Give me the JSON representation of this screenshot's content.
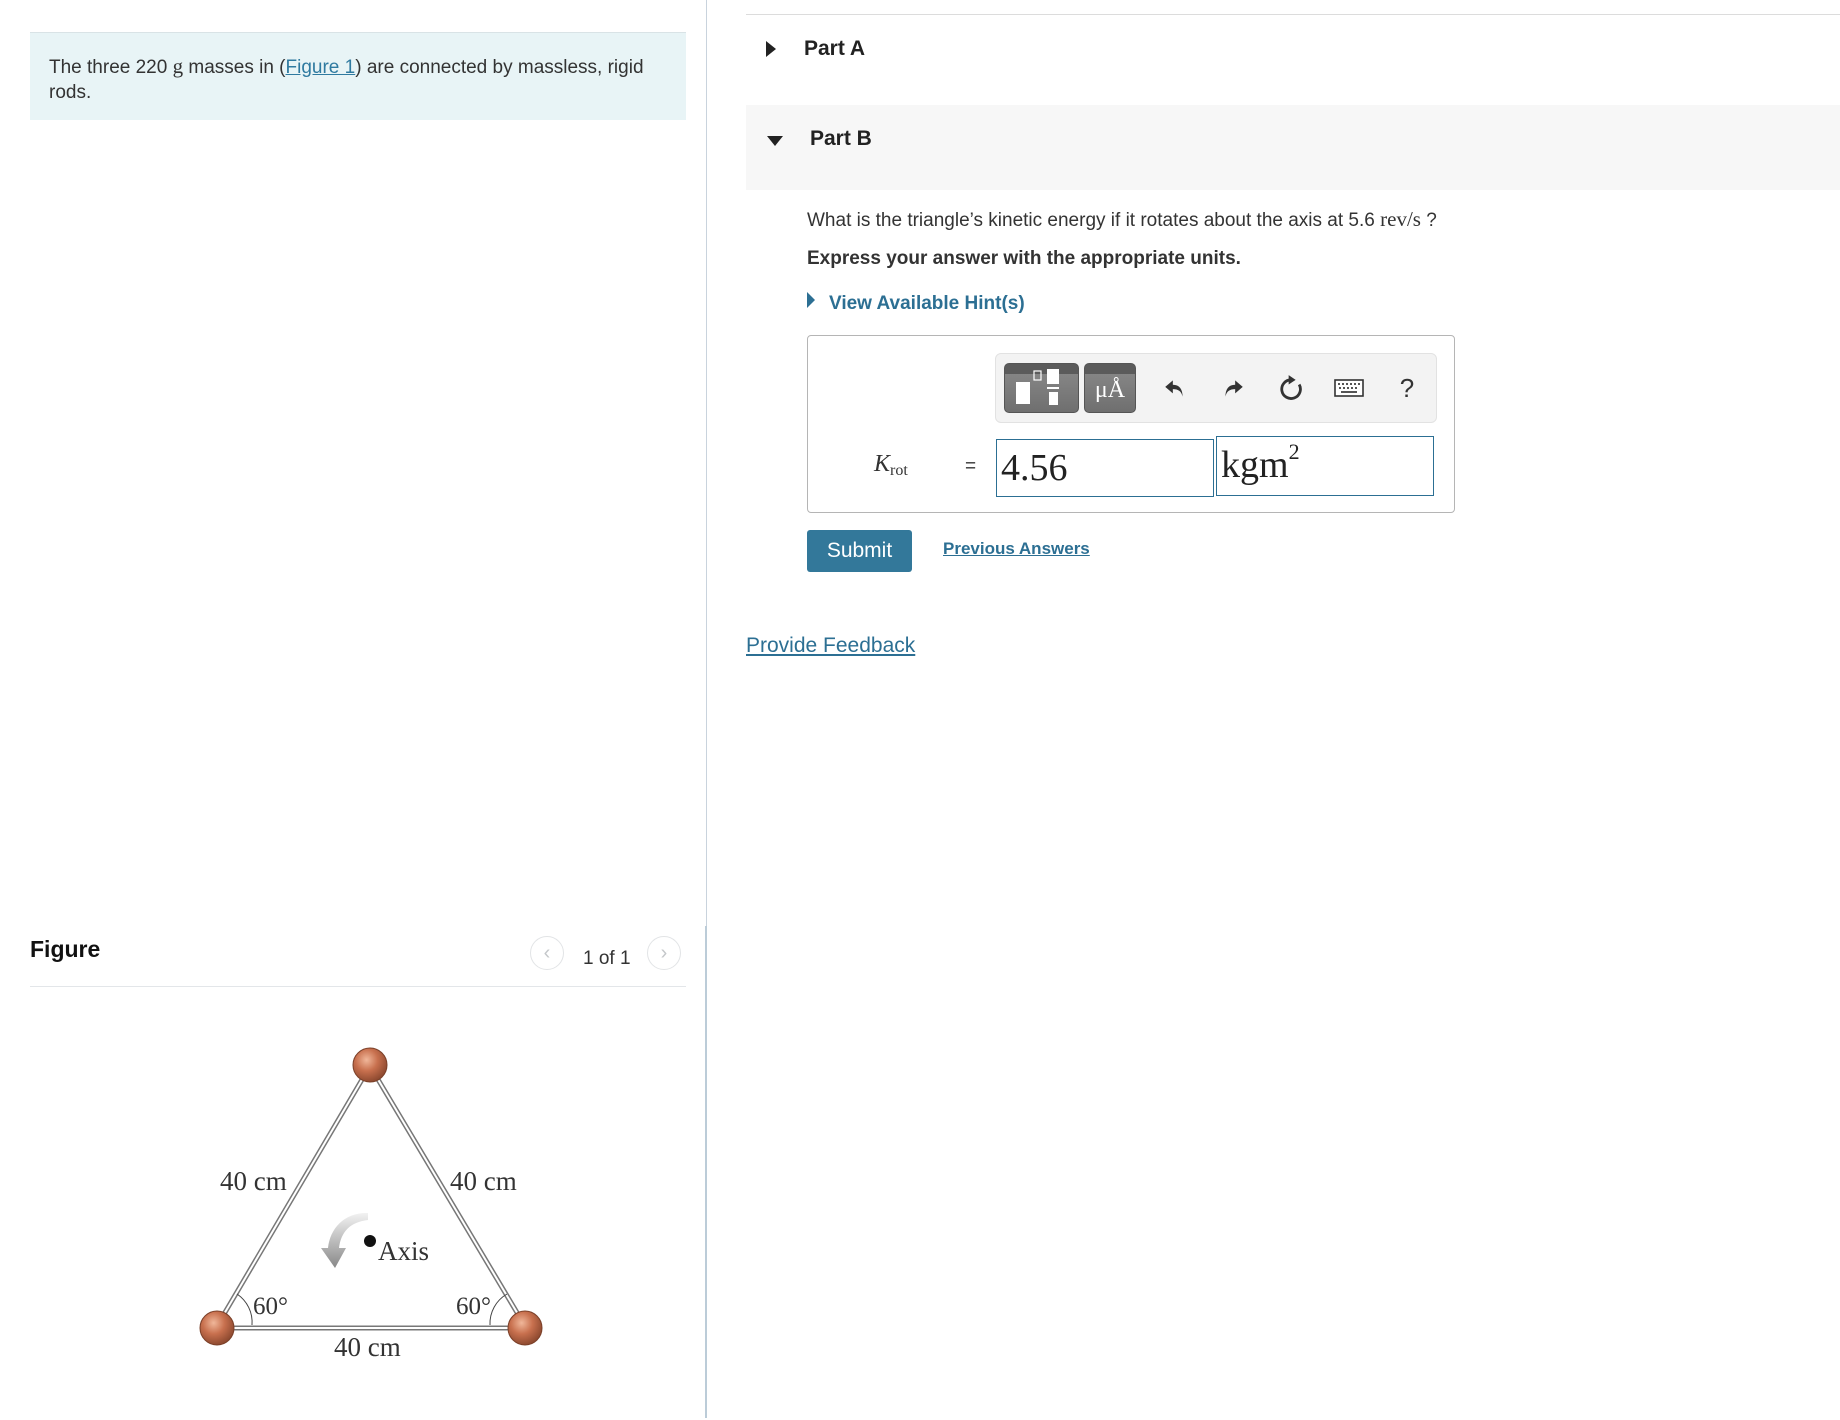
{
  "problem": {
    "intro_before": "The three 220 ",
    "intro_unit": "g",
    "intro_middle": " masses in (",
    "figure_link": "Figure 1",
    "intro_after": ") are connected by massless, rigid rods."
  },
  "figure": {
    "title": "Figure",
    "page_indicator": "1 of 1",
    "prev_icon": "chevron-left-icon",
    "next_icon": "chevron-right-icon",
    "labels": {
      "left_side": "40 cm",
      "right_side": "40 cm",
      "bottom_side": "40 cm",
      "left_angle": "60°",
      "right_angle": "60°",
      "axis": "Axis"
    },
    "colors": {
      "mass": "#c8704e",
      "rod": "#8a8a8a"
    }
  },
  "parts": {
    "part_a": {
      "label": "Part A",
      "state": "collapsed"
    },
    "part_b": {
      "label": "Part B",
      "state": "expanded"
    }
  },
  "question": {
    "text": "What is the triangle’s kinetic energy if it rotates about the axis at 5.6 ",
    "unit": "rev/s",
    "suffix": " ?",
    "instruction": "Express your answer with the appropriate units.",
    "hint_label": "View Available Hint(s)"
  },
  "answer": {
    "variable": "K",
    "variable_sub": "rot",
    "equals": "=",
    "value": "4.56",
    "unit_base": "kgm",
    "unit_exp": "2",
    "toolbar": {
      "templates_icon": "templates-icon",
      "symbols_label": "μÅ",
      "undo_icon": "undo-icon",
      "redo_icon": "redo-icon",
      "reset_icon": "reset-icon",
      "keyboard_icon": "keyboard-icon",
      "help_label": "?"
    }
  },
  "actions": {
    "submit": "Submit",
    "previous_answers": "Previous Answers",
    "feedback": "Provide Feedback"
  },
  "colors": {
    "accent": "#33789a",
    "link": "#2c6f93",
    "intro_bg": "#e8f4f6",
    "part_b_bg": "#f7f7f7"
  }
}
